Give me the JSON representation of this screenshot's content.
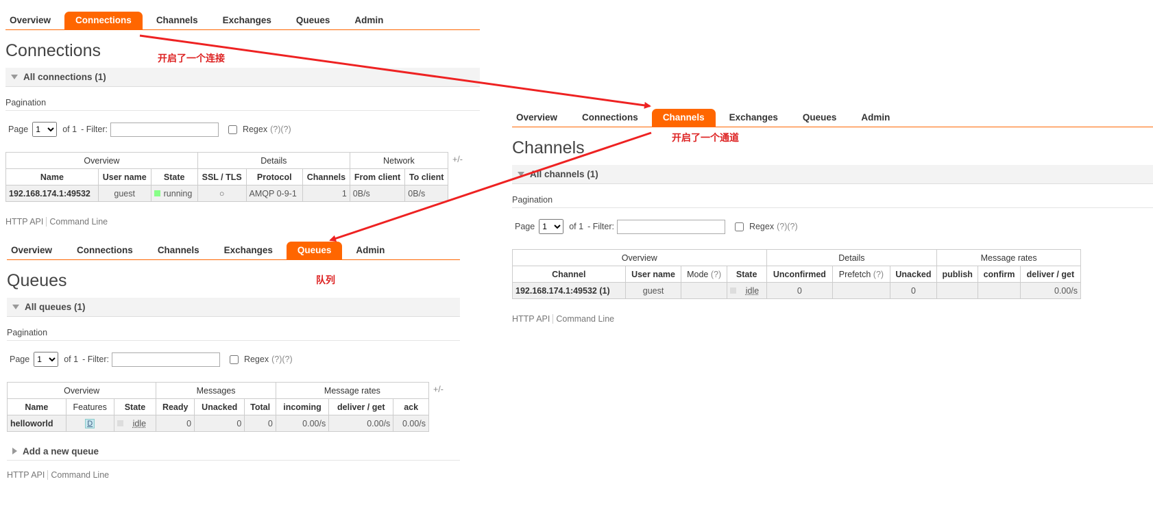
{
  "nav_tabs": [
    "Overview",
    "Connections",
    "Channels",
    "Exchanges",
    "Queues",
    "Admin"
  ],
  "connections_panel": {
    "active_tab": "Connections",
    "title": "Connections",
    "section": "All connections (1)",
    "pagination_label": "Pagination",
    "page_label": "Page",
    "page_value": "1",
    "of_label": "of 1",
    "filter_label": "- Filter:",
    "regex_label": "Regex",
    "regex_help": "(?)(?)",
    "plusminus": "+/-",
    "groups": [
      "Overview",
      "Details",
      "Network"
    ],
    "columns": [
      "Name",
      "User name",
      "State",
      "SSL / TLS",
      "Protocol",
      "Channels",
      "From client",
      "To client"
    ],
    "row": {
      "name": "192.168.174.1:49532",
      "user": "guest",
      "state": "running",
      "ssl": "○",
      "protocol": "AMQP 0-9-1",
      "channels": "1",
      "from_client": "0B/s",
      "to_client": "0B/s"
    },
    "footer_api": "HTTP API",
    "footer_cli": "Command Line"
  },
  "channels_panel": {
    "active_tab": "Channels",
    "title": "Channels",
    "section": "All channels (1)",
    "pagination_label": "Pagination",
    "page_label": "Page",
    "page_value": "1",
    "of_label": "of 1",
    "filter_label": "- Filter:",
    "regex_label": "Regex",
    "regex_help": "(?)(?)",
    "groups": [
      "Overview",
      "Details",
      "Message rates"
    ],
    "columns": [
      "Channel",
      "User name",
      "Mode",
      "State",
      "Unconfirmed",
      "Prefetch",
      "Unacked",
      "publish",
      "confirm",
      "deliver / get"
    ],
    "mode_help": "(?)",
    "prefetch_help": "(?)",
    "row": {
      "channel": "192.168.174.1:49532 (1)",
      "user": "guest",
      "mode": "",
      "state": "idle",
      "unconfirmed": "0",
      "prefetch": "",
      "unacked": "0",
      "publish": "",
      "confirm": "",
      "deliver_get": "0.00/s"
    },
    "footer_api": "HTTP API",
    "footer_cli": "Command Line"
  },
  "queues_panel": {
    "active_tab": "Queues",
    "title": "Queues",
    "section": "All queues (1)",
    "pagination_label": "Pagination",
    "page_label": "Page",
    "page_value": "1",
    "of_label": "of 1",
    "filter_label": "- Filter:",
    "regex_label": "Regex",
    "regex_help": "(?)(?)",
    "plusminus": "+/-",
    "groups": [
      "Overview",
      "Messages",
      "Message rates"
    ],
    "columns": [
      "Name",
      "Features",
      "State",
      "Ready",
      "Unacked",
      "Total",
      "incoming",
      "deliver / get",
      "ack"
    ],
    "row": {
      "name": "helloworld",
      "features": "D",
      "state": "idle",
      "ready": "0",
      "unacked": "0",
      "total": "0",
      "incoming": "0.00/s",
      "deliver_get": "0.00/s",
      "ack": "0.00/s"
    },
    "add_queue": "Add a new queue",
    "footer_api": "HTTP API",
    "footer_cli": "Command Line"
  },
  "annotations": {
    "connection": "开启了一个连接",
    "channel": "开启了一个通道",
    "queue": "队列"
  },
  "colors": {
    "accent": "#ff6600",
    "annotation": "#dd2222",
    "running": "#8f8",
    "idle": "#ddd"
  }
}
